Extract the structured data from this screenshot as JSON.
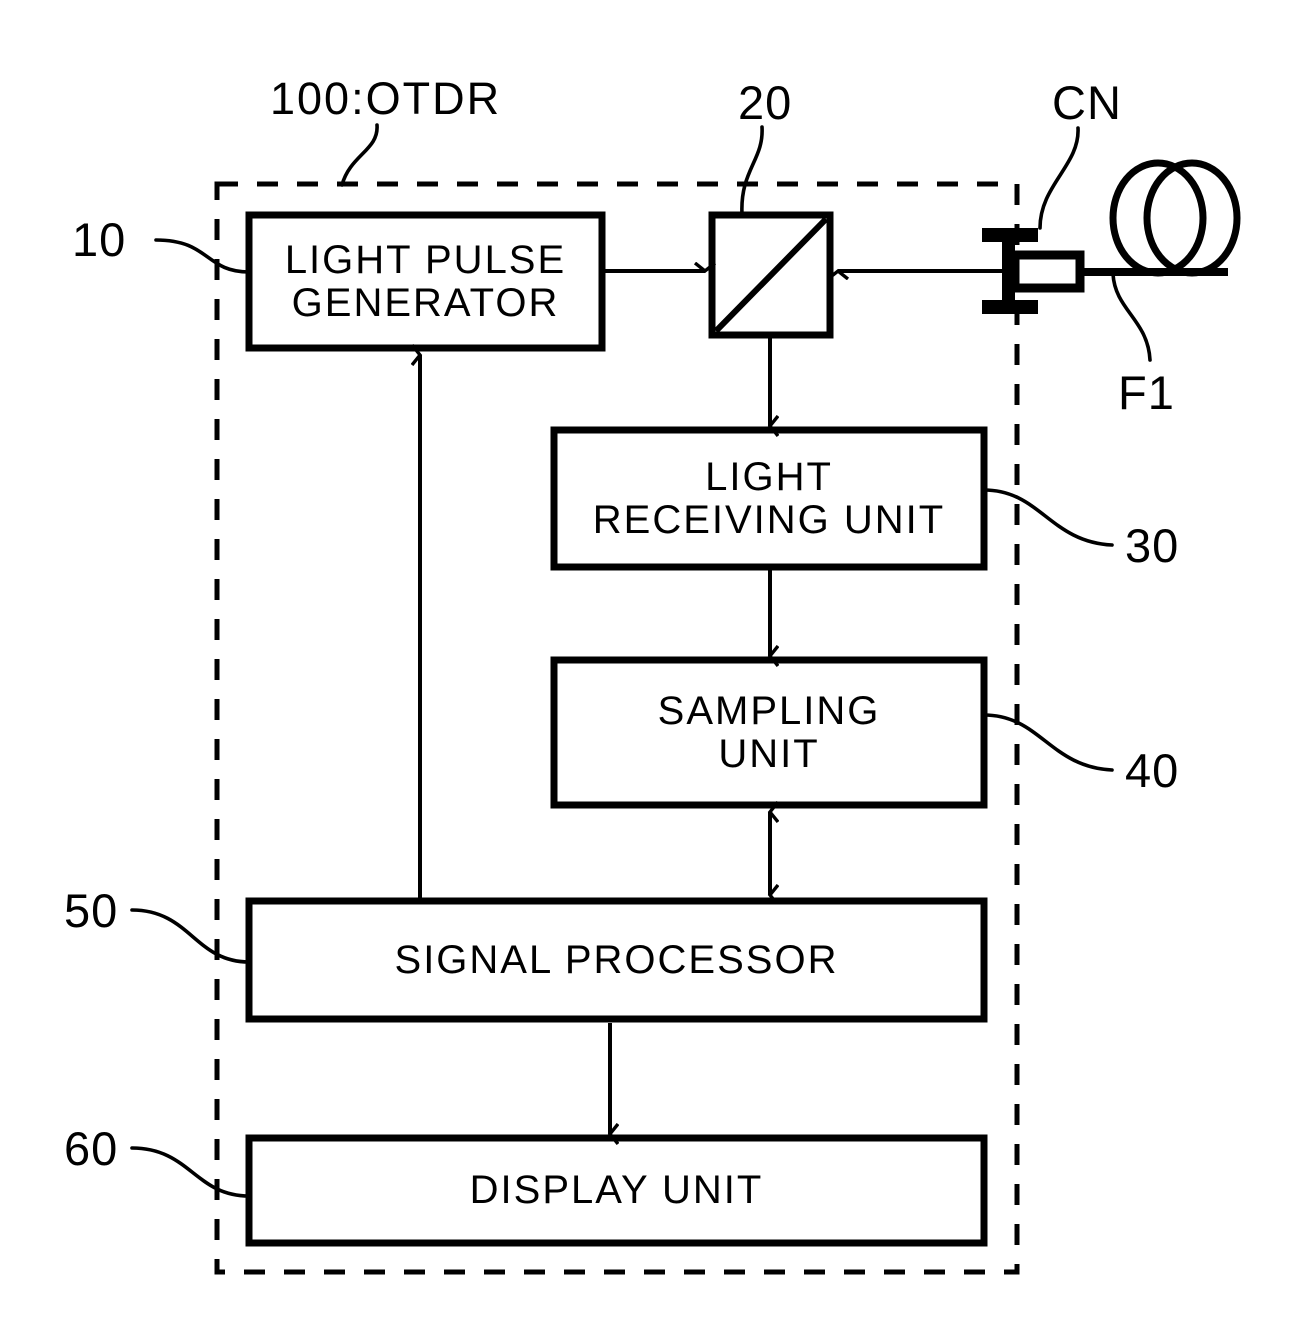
{
  "figure": {
    "title_label": "100:OTDR",
    "blocks": [
      {
        "id": "light-pulse-generator",
        "lines": [
          "LIGHT PULSE",
          "GENERATOR"
        ],
        "ref": "10"
      },
      {
        "id": "beam-splitter",
        "lines": [],
        "ref": "20"
      },
      {
        "id": "light-receiving-unit",
        "lines": [
          "LIGHT",
          "RECEIVING UNIT"
        ],
        "ref": "30"
      },
      {
        "id": "sampling-unit",
        "lines": [
          "SAMPLING",
          "UNIT"
        ],
        "ref": "40"
      },
      {
        "id": "signal-processor",
        "lines": [
          "SIGNAL PROCESSOR"
        ],
        "ref": "50"
      },
      {
        "id": "display-unit",
        "lines": [
          "DISPLAY UNIT"
        ],
        "ref": "60"
      }
    ],
    "refs": {
      "light_pulse_generator": "10",
      "beam_splitter": "20",
      "light_receiving_unit": "30",
      "sampling_unit": "40",
      "signal_processor": "50",
      "display_unit": "60",
      "connector": "CN",
      "fiber": "F1"
    },
    "text": {
      "light_pulse_generator_line1": "LIGHT PULSE",
      "light_pulse_generator_line2": "GENERATOR",
      "light_receiving_unit_line1": "LIGHT",
      "light_receiving_unit_line2": "RECEIVING UNIT",
      "sampling_unit_line1": "SAMPLING",
      "sampling_unit_line2": "UNIT",
      "signal_processor": "SIGNAL PROCESSOR",
      "display_unit": "DISPLAY UNIT"
    },
    "colors": {
      "stroke": "#000000",
      "background": "#ffffff"
    }
  }
}
